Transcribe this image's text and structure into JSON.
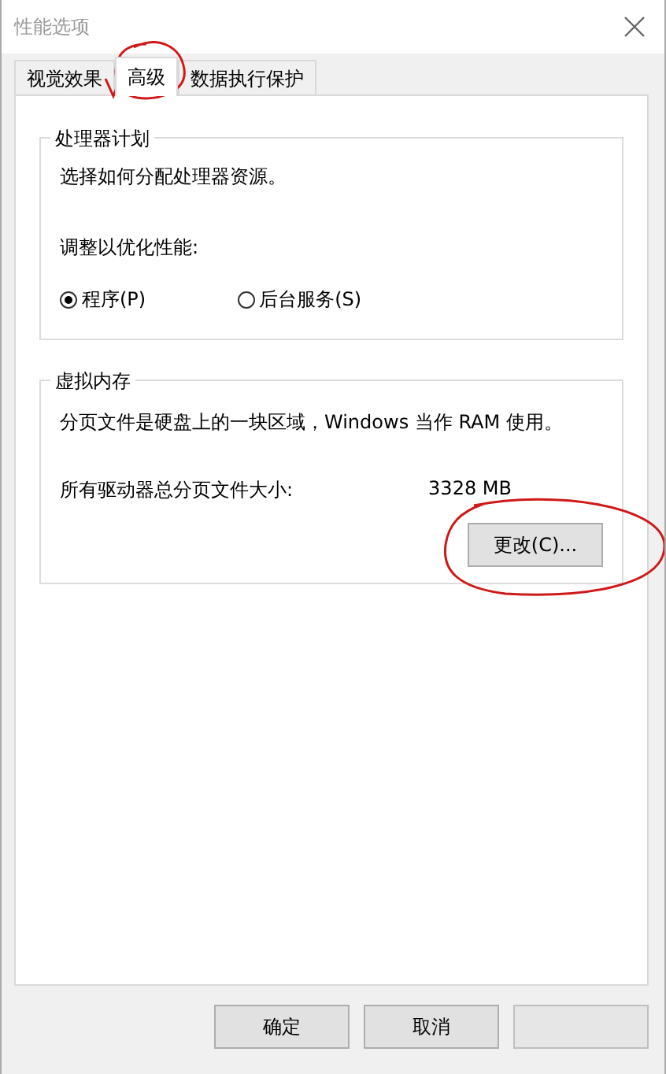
{
  "window": {
    "title": "性能选项"
  },
  "tabs": [
    {
      "label": "视觉效果",
      "selected": false
    },
    {
      "label": "高级",
      "selected": true
    },
    {
      "label": "数据执行保护",
      "selected": false
    }
  ],
  "processor_group": {
    "title": "处理器计划",
    "description": "选择如何分配处理器资源。",
    "prompt": "调整以优化性能:",
    "options": [
      {
        "label": "程序(P)",
        "selected": true
      },
      {
        "label": "后台服务(S)",
        "selected": false
      }
    ]
  },
  "memory_group": {
    "title": "虚拟内存",
    "description": "分页文件是硬盘上的一块区域，Windows 当作 RAM 使用。",
    "size_label": "所有驱动器总分页文件大小:",
    "size_value": "3328 MB",
    "change_button": "更改(C)..."
  },
  "buttons": [
    {
      "label": "确定",
      "disabled": false
    },
    {
      "label": "取消",
      "disabled": false
    },
    {
      "disabled": true
    }
  ]
}
